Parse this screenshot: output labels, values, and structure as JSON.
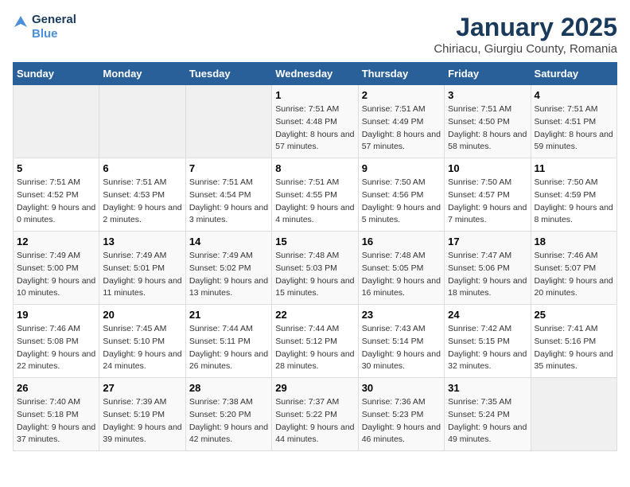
{
  "logo": {
    "line1": "General",
    "line2": "Blue"
  },
  "title": "January 2025",
  "subtitle": "Chiriacu, Giurgiu County, Romania",
  "weekdays": [
    "Sunday",
    "Monday",
    "Tuesday",
    "Wednesday",
    "Thursday",
    "Friday",
    "Saturday"
  ],
  "weeks": [
    [
      {
        "day": "",
        "info": ""
      },
      {
        "day": "",
        "info": ""
      },
      {
        "day": "",
        "info": ""
      },
      {
        "day": "1",
        "info": "Sunrise: 7:51 AM\nSunset: 4:48 PM\nDaylight: 8 hours and 57 minutes."
      },
      {
        "day": "2",
        "info": "Sunrise: 7:51 AM\nSunset: 4:49 PM\nDaylight: 8 hours and 57 minutes."
      },
      {
        "day": "3",
        "info": "Sunrise: 7:51 AM\nSunset: 4:50 PM\nDaylight: 8 hours and 58 minutes."
      },
      {
        "day": "4",
        "info": "Sunrise: 7:51 AM\nSunset: 4:51 PM\nDaylight: 8 hours and 59 minutes."
      }
    ],
    [
      {
        "day": "5",
        "info": "Sunrise: 7:51 AM\nSunset: 4:52 PM\nDaylight: 9 hours and 0 minutes."
      },
      {
        "day": "6",
        "info": "Sunrise: 7:51 AM\nSunset: 4:53 PM\nDaylight: 9 hours and 2 minutes."
      },
      {
        "day": "7",
        "info": "Sunrise: 7:51 AM\nSunset: 4:54 PM\nDaylight: 9 hours and 3 minutes."
      },
      {
        "day": "8",
        "info": "Sunrise: 7:51 AM\nSunset: 4:55 PM\nDaylight: 9 hours and 4 minutes."
      },
      {
        "day": "9",
        "info": "Sunrise: 7:50 AM\nSunset: 4:56 PM\nDaylight: 9 hours and 5 minutes."
      },
      {
        "day": "10",
        "info": "Sunrise: 7:50 AM\nSunset: 4:57 PM\nDaylight: 9 hours and 7 minutes."
      },
      {
        "day": "11",
        "info": "Sunrise: 7:50 AM\nSunset: 4:59 PM\nDaylight: 9 hours and 8 minutes."
      }
    ],
    [
      {
        "day": "12",
        "info": "Sunrise: 7:49 AM\nSunset: 5:00 PM\nDaylight: 9 hours and 10 minutes."
      },
      {
        "day": "13",
        "info": "Sunrise: 7:49 AM\nSunset: 5:01 PM\nDaylight: 9 hours and 11 minutes."
      },
      {
        "day": "14",
        "info": "Sunrise: 7:49 AM\nSunset: 5:02 PM\nDaylight: 9 hours and 13 minutes."
      },
      {
        "day": "15",
        "info": "Sunrise: 7:48 AM\nSunset: 5:03 PM\nDaylight: 9 hours and 15 minutes."
      },
      {
        "day": "16",
        "info": "Sunrise: 7:48 AM\nSunset: 5:05 PM\nDaylight: 9 hours and 16 minutes."
      },
      {
        "day": "17",
        "info": "Sunrise: 7:47 AM\nSunset: 5:06 PM\nDaylight: 9 hours and 18 minutes."
      },
      {
        "day": "18",
        "info": "Sunrise: 7:46 AM\nSunset: 5:07 PM\nDaylight: 9 hours and 20 minutes."
      }
    ],
    [
      {
        "day": "19",
        "info": "Sunrise: 7:46 AM\nSunset: 5:08 PM\nDaylight: 9 hours and 22 minutes."
      },
      {
        "day": "20",
        "info": "Sunrise: 7:45 AM\nSunset: 5:10 PM\nDaylight: 9 hours and 24 minutes."
      },
      {
        "day": "21",
        "info": "Sunrise: 7:44 AM\nSunset: 5:11 PM\nDaylight: 9 hours and 26 minutes."
      },
      {
        "day": "22",
        "info": "Sunrise: 7:44 AM\nSunset: 5:12 PM\nDaylight: 9 hours and 28 minutes."
      },
      {
        "day": "23",
        "info": "Sunrise: 7:43 AM\nSunset: 5:14 PM\nDaylight: 9 hours and 30 minutes."
      },
      {
        "day": "24",
        "info": "Sunrise: 7:42 AM\nSunset: 5:15 PM\nDaylight: 9 hours and 32 minutes."
      },
      {
        "day": "25",
        "info": "Sunrise: 7:41 AM\nSunset: 5:16 PM\nDaylight: 9 hours and 35 minutes."
      }
    ],
    [
      {
        "day": "26",
        "info": "Sunrise: 7:40 AM\nSunset: 5:18 PM\nDaylight: 9 hours and 37 minutes."
      },
      {
        "day": "27",
        "info": "Sunrise: 7:39 AM\nSunset: 5:19 PM\nDaylight: 9 hours and 39 minutes."
      },
      {
        "day": "28",
        "info": "Sunrise: 7:38 AM\nSunset: 5:20 PM\nDaylight: 9 hours and 42 minutes."
      },
      {
        "day": "29",
        "info": "Sunrise: 7:37 AM\nSunset: 5:22 PM\nDaylight: 9 hours and 44 minutes."
      },
      {
        "day": "30",
        "info": "Sunrise: 7:36 AM\nSunset: 5:23 PM\nDaylight: 9 hours and 46 minutes."
      },
      {
        "day": "31",
        "info": "Sunrise: 7:35 AM\nSunset: 5:24 PM\nDaylight: 9 hours and 49 minutes."
      },
      {
        "day": "",
        "info": ""
      }
    ]
  ]
}
